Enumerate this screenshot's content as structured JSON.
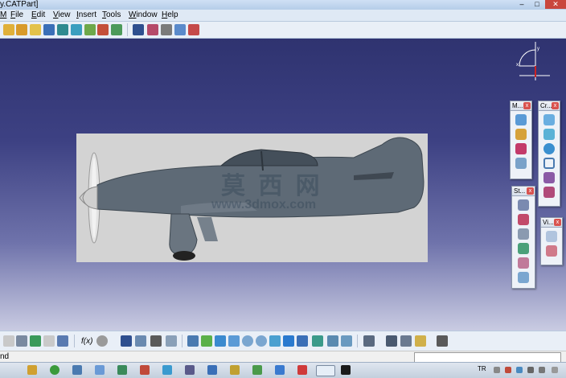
{
  "window": {
    "title": "y.CATPart]",
    "minimize": "–",
    "maximize": "□",
    "close": "✕"
  },
  "menu": {
    "items": [
      {
        "prefix": "",
        "underline": "M",
        "rest": ""
      },
      {
        "prefix": "",
        "underline": "F",
        "rest": "ile"
      },
      {
        "prefix": "",
        "underline": "E",
        "rest": "dit"
      },
      {
        "prefix": "",
        "underline": "V",
        "rest": "iew"
      },
      {
        "prefix": "",
        "underline": "I",
        "rest": "nsert"
      },
      {
        "prefix": "",
        "underline": "T",
        "rest": "ools"
      },
      {
        "prefix": "",
        "underline": "W",
        "rest": "indow"
      },
      {
        "prefix": "",
        "underline": "H",
        "rest": "elp"
      }
    ]
  },
  "viewport": {
    "background_top": "#2f3370",
    "background_bottom": "#c9cbe2",
    "watermark_cn": "莫 西 网",
    "watermark_url": "www.3dmox.com",
    "compass_x": "x",
    "compass_y": "y"
  },
  "palettes": {
    "m": {
      "label": "M..."
    },
    "cr": {
      "label": "Cr..."
    },
    "st": {
      "label": "St..."
    },
    "vi": {
      "label": "Vi..."
    }
  },
  "bottom_toolbar": {
    "formula_label": "f(x)"
  },
  "status": {
    "text": "nd",
    "command_placeholder": ""
  },
  "taskbar": {
    "tray_lang": "TR"
  },
  "colors": {
    "accent": "#3a6fb7",
    "plane_body": "#5e6a76",
    "panel_bg": "#d3d3d3"
  }
}
